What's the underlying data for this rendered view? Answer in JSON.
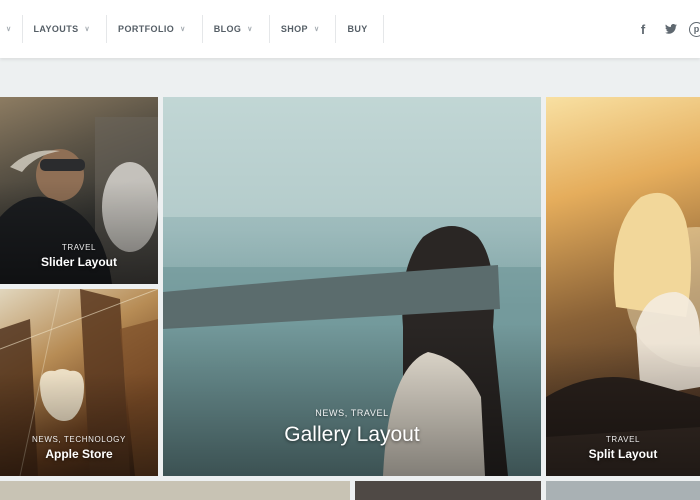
{
  "nav": {
    "items": [
      {
        "label": "",
        "has_chevron": true
      },
      {
        "label": "LAYOUTS",
        "has_chevron": true
      },
      {
        "label": "PORTFOLIO",
        "has_chevron": true
      },
      {
        "label": "BLOG",
        "has_chevron": true
      },
      {
        "label": "SHOP",
        "has_chevron": true
      },
      {
        "label": "BUY",
        "has_chevron": false
      }
    ],
    "social_icons": [
      "facebook-icon",
      "twitter-icon",
      "pinterest-icon"
    ],
    "social_glyphs": {
      "facebook": "f",
      "twitter": "𝕥",
      "pinterest": "p"
    }
  },
  "posts": [
    {
      "category": "TRAVEL",
      "title": "Slider Layout"
    },
    {
      "category": "NEWS, TECHNOLOGY",
      "title": "Apple Store"
    },
    {
      "category": "NEWS, TRAVEL",
      "title": "Gallery Layout"
    },
    {
      "category": "TRAVEL",
      "title": "Split Layout"
    }
  ],
  "colors": {
    "page_background": "#edf0f1",
    "header_background": "#ffffff",
    "nav_text": "#555e66"
  }
}
